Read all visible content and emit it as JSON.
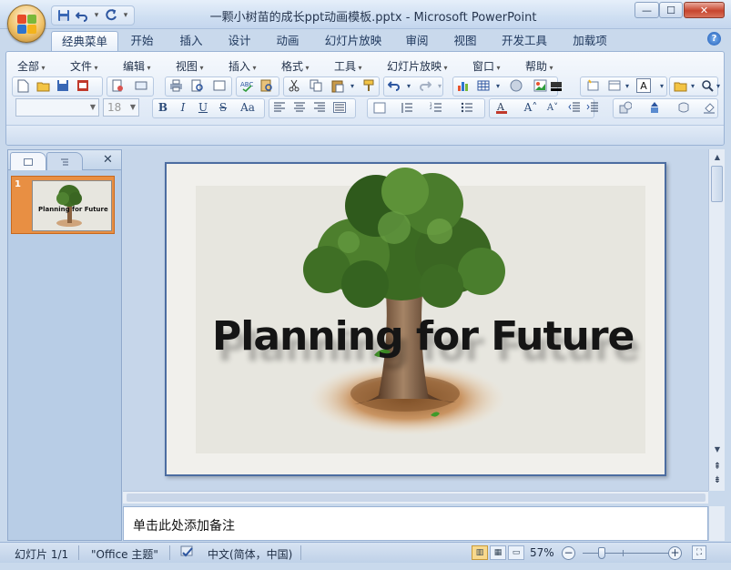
{
  "window": {
    "title": "一颗小树苗的成长ppt动画模板.pptx - Microsoft PowerPoint",
    "minimize": "—",
    "maximize": "☐",
    "close": "✕"
  },
  "quick_access": {
    "save": "💾",
    "undo": "↶",
    "redo": "↻",
    "dropdown": "▾"
  },
  "tabs": [
    {
      "label": "经典菜单",
      "active": true
    },
    {
      "label": "开始"
    },
    {
      "label": "插入"
    },
    {
      "label": "设计"
    },
    {
      "label": "动画"
    },
    {
      "label": "幻灯片放映"
    },
    {
      "label": "审阅"
    },
    {
      "label": "视图"
    },
    {
      "label": "开发工具"
    },
    {
      "label": "加载项"
    }
  ],
  "help": "?",
  "menus": [
    "全部",
    "文件",
    "编辑",
    "视图",
    "插入",
    "格式",
    "工具",
    "幻灯片放映",
    "窗口",
    "帮助"
  ],
  "format": {
    "font_size": "18"
  },
  "left_panel": {
    "slide_number": "1",
    "thumb_text": "Planning for Future",
    "close": "✕"
  },
  "slide": {
    "title": "Planning for Future"
  },
  "notes": {
    "placeholder": "单击此处添加备注"
  },
  "status": {
    "slide": "幻灯片 1/1",
    "theme": "\"Office 主题\"",
    "language": "中文(简体，中国)",
    "zoom": "57%"
  },
  "colors": {
    "accent_orange": "#e88f43",
    "slide_bg": "#e7e6df",
    "title_text": "#151515"
  }
}
